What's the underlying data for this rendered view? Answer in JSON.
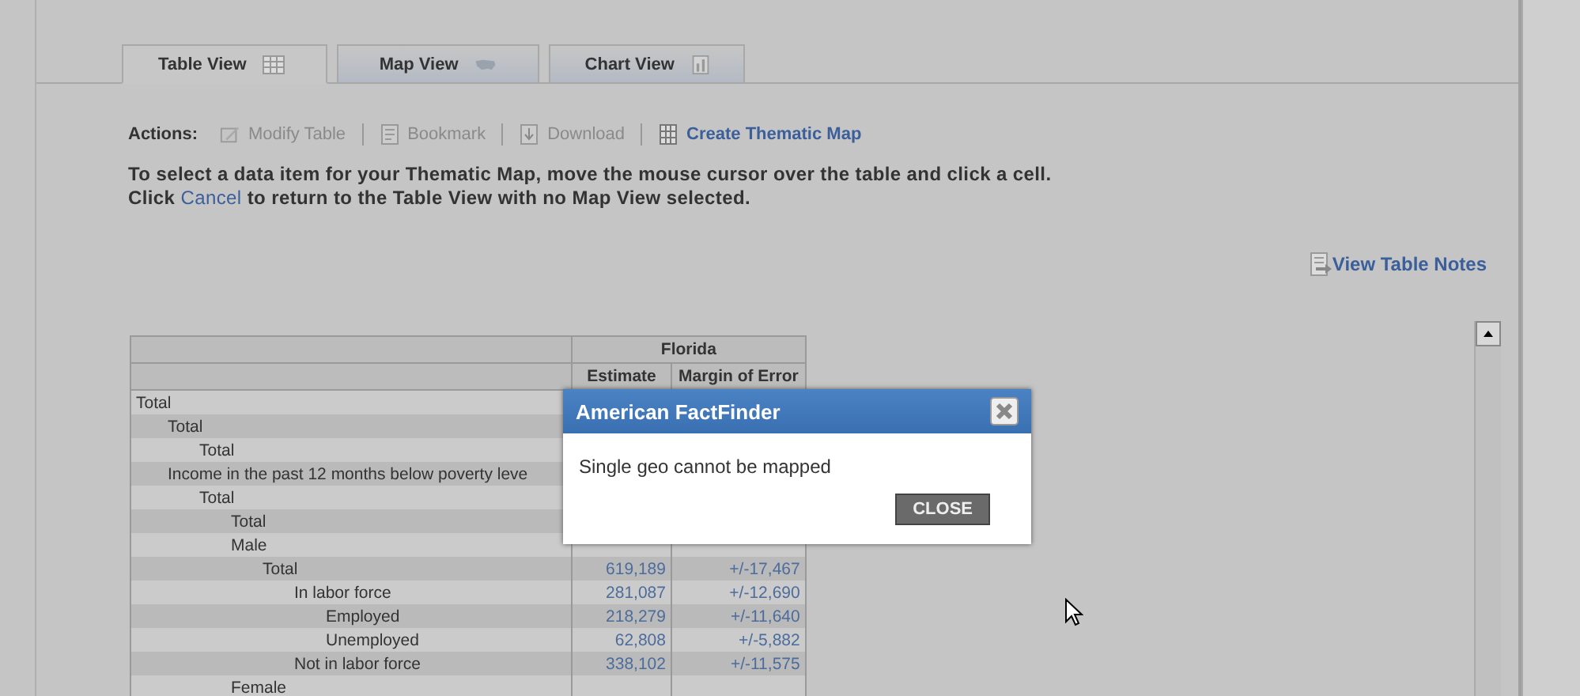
{
  "tabs": [
    {
      "label": "Table View",
      "selected": true
    },
    {
      "label": "Map View",
      "selected": false
    },
    {
      "label": "Chart View",
      "selected": false
    }
  ],
  "actions": {
    "label": "Actions:",
    "items": [
      {
        "label": "Modify Table",
        "disabled": true
      },
      {
        "label": "Bookmark",
        "disabled": true
      },
      {
        "label": "Download",
        "disabled": true
      },
      {
        "label": "Create Thematic Map",
        "disabled": false
      }
    ]
  },
  "instructions": {
    "line_1": "To select a data item for your Thematic Map, move the mouse cursor over the table and click a cell.",
    "before_link": "Click ",
    "link": "Cancel",
    "after_link": " to return to the Table View with no Map View selected."
  },
  "table_notes_link": "View Table Notes",
  "table": {
    "group_header": "Florida",
    "columns": [
      "Estimate",
      "Margin of Error"
    ],
    "rows": [
      {
        "label": "Total",
        "children": [
          {
            "label": "Total",
            "children": [
              {
                "label": "Total"
              }
            ]
          },
          {
            "label": "Income in the past 12 months below poverty leve",
            "children": [
              {
                "label": "Total",
                "children": [
                  {
                    "label": "Total"
                  },
                  {
                    "label": "Male",
                    "children": [
                      {
                        "label": "Total",
                        "estimate": "619,189",
                        "margin": "+/-17,467",
                        "children": [
                          {
                            "label": "In labor force",
                            "estimate": "281,087",
                            "margin": "+/-12,690",
                            "children": [
                              {
                                "label": "Employed",
                                "estimate": "218,279",
                                "margin": "+/-11,640"
                              },
                              {
                                "label": "Unemployed",
                                "estimate": "62,808",
                                "margin": "+/-5,882"
                              }
                            ]
                          },
                          {
                            "label": "Not in labor force",
                            "estimate": "338,102",
                            "margin": "+/-11,575"
                          }
                        ]
                      }
                    ]
                  },
                  {
                    "label": "Female"
                  }
                ]
              }
            ]
          }
        ]
      }
    ]
  },
  "dialog": {
    "title": "American FactFinder",
    "message": "Single geo cannot be mapped",
    "close_button": "CLOSE"
  }
}
